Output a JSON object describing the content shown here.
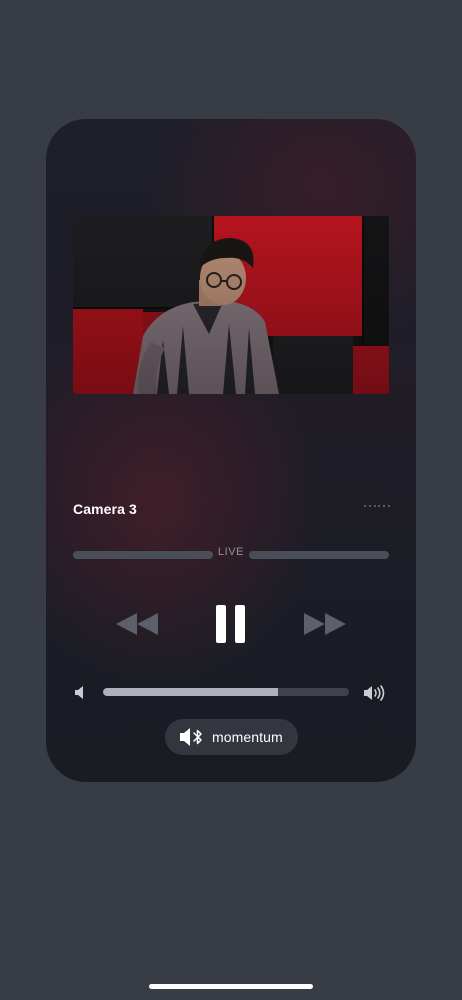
{
  "player": {
    "title": "Camera 3",
    "status_label": "LIVE",
    "volume_level": 0.71,
    "output_device": "momentum"
  },
  "icons": {
    "more": "more-dots-icon",
    "rewind": "rewind-icon",
    "pause": "pause-icon",
    "forward": "fast-forward-icon",
    "volume_min": "speaker-low-icon",
    "volume_max": "speaker-high-icon",
    "output": "bluetooth-speaker-icon"
  },
  "colors": {
    "background": "#383c45",
    "card": "#1d1f29",
    "accent": "#ffffff",
    "muted": "#6d717b",
    "track": "#4a4e58",
    "fill": "#aeb1ba"
  }
}
